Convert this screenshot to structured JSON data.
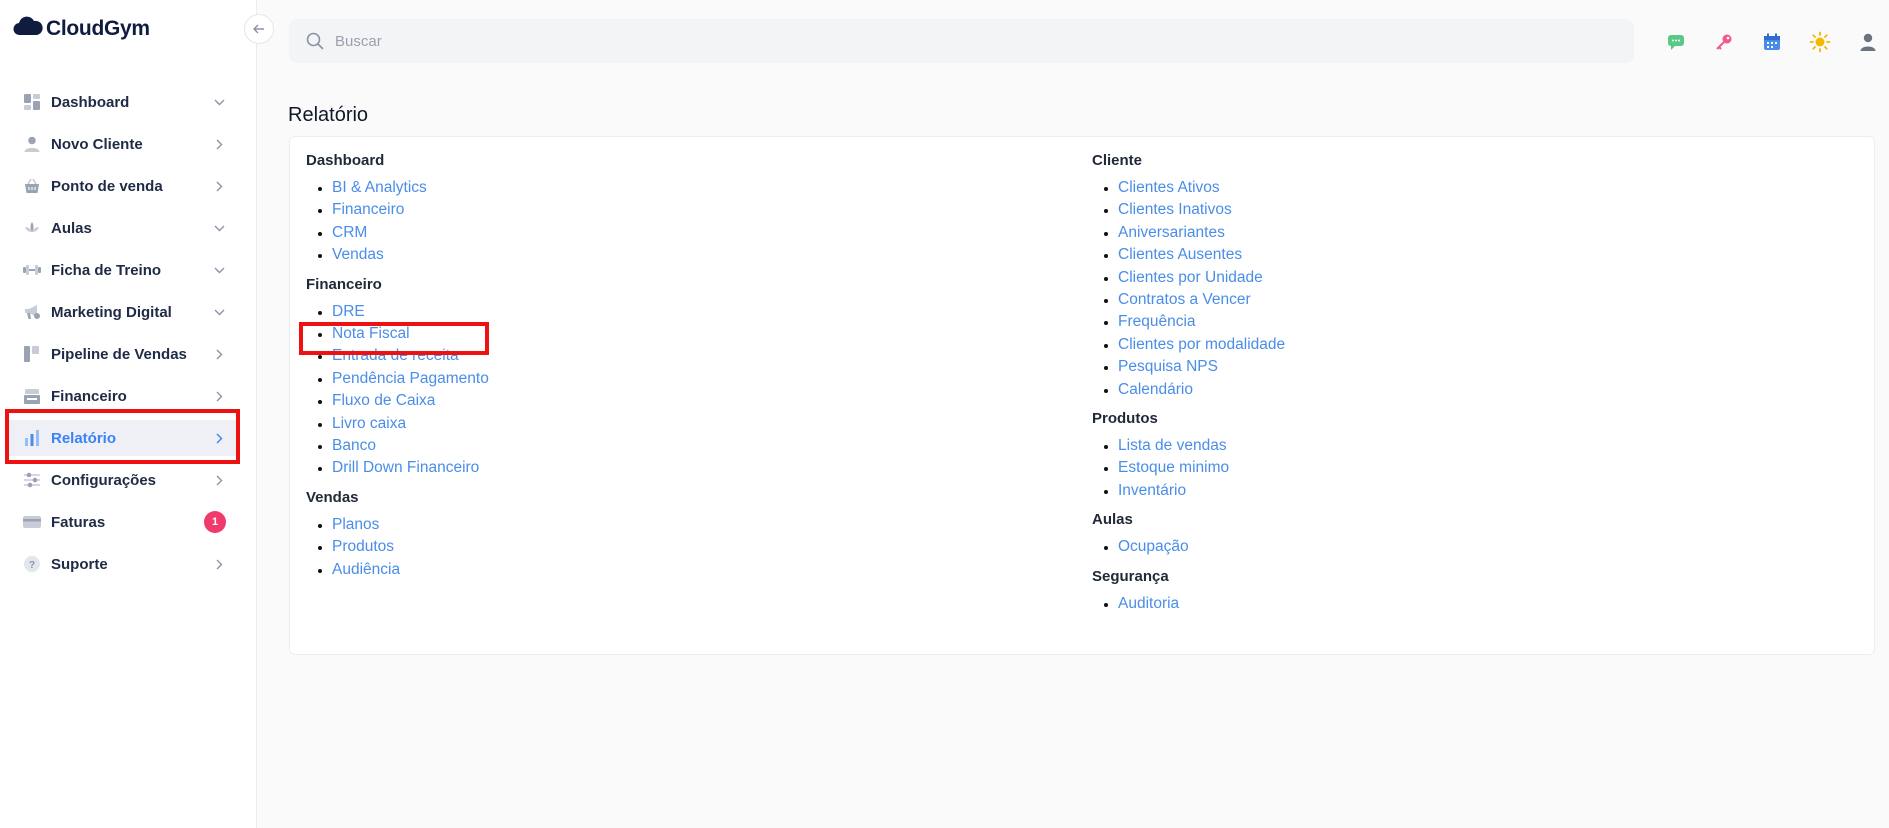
{
  "app": {
    "name": "CloudGym"
  },
  "search": {
    "placeholder": "Buscar"
  },
  "sidebar": {
    "items": [
      {
        "label": "Dashboard",
        "icon": "dashboard-icon",
        "arrow": "down"
      },
      {
        "label": "Novo Cliente",
        "icon": "user-icon",
        "arrow": "right"
      },
      {
        "label": "Ponto de venda",
        "icon": "basket-icon",
        "arrow": "right"
      },
      {
        "label": "Aulas",
        "icon": "lotus-icon",
        "arrow": "down"
      },
      {
        "label": "Ficha de Treino",
        "icon": "dumbbell-icon",
        "arrow": "down"
      },
      {
        "label": "Marketing Digital",
        "icon": "megaphone-icon",
        "arrow": "down"
      },
      {
        "label": "Pipeline de Vendas",
        "icon": "kanban-icon",
        "arrow": "right"
      },
      {
        "label": "Financeiro",
        "icon": "register-icon",
        "arrow": "right"
      },
      {
        "label": "Relatório",
        "icon": "bar-chart-icon",
        "arrow": "right",
        "active": true
      },
      {
        "label": "Configurações",
        "icon": "sliders-icon",
        "arrow": "right"
      },
      {
        "label": "Faturas",
        "icon": "card-icon",
        "badge": "1"
      },
      {
        "label": "Suporte",
        "icon": "help-icon",
        "arrow": "right"
      }
    ]
  },
  "top_icons": [
    "chat-icon",
    "key-icon",
    "calendar-icon",
    "sun-icon",
    "profile-icon"
  ],
  "main": {
    "title": "Relatório",
    "left_sections": [
      {
        "title": "Dashboard",
        "links": [
          "BI & Analytics",
          "Financeiro",
          "CRM",
          "Vendas"
        ]
      },
      {
        "title": "Financeiro",
        "links": [
          "DRE",
          "Nota Fiscal",
          "Entrada de receita",
          "Pendência Pagamento",
          "Fluxo de Caixa",
          "Livro caixa",
          "Banco",
          "Drill Down Financeiro"
        ]
      },
      {
        "title": "Vendas",
        "links": [
          "Planos",
          "Produtos",
          "Audiência"
        ]
      }
    ],
    "right_sections": [
      {
        "title": "Cliente",
        "links": [
          "Clientes Ativos",
          "Clientes Inativos",
          "Aniversariantes",
          "Clientes Ausentes",
          "Clientes por Unidade",
          "Contratos a Vencer",
          "Frequência",
          "Clientes por modalidade",
          "Pesquisa NPS",
          "Calendário"
        ]
      },
      {
        "title": "Produtos",
        "links": [
          "Lista de vendas",
          "Estoque minimo",
          "Inventário"
        ]
      },
      {
        "title": "Aulas",
        "links": [
          "Ocupação"
        ]
      },
      {
        "title": "Segurança",
        "links": [
          "Auditoria"
        ]
      }
    ]
  },
  "colors": {
    "accent": "#3b82f6",
    "highlight": "#ee1111",
    "badge": "#ef3a6b"
  }
}
